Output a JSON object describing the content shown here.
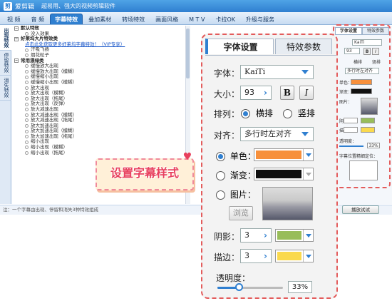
{
  "app": {
    "title": "爱剪辑",
    "subtitle": "超易用、强大的视频剪辑软件"
  },
  "menu": [
    "视 频",
    "音 频",
    "字幕特效",
    "叠加素材",
    "转场特效",
    "画面风格",
    "M T V",
    "卡拉OK",
    "升级与服务"
  ],
  "menu_active": 2,
  "vtabs": [
    "出现特效",
    "停留特效",
    "消失特效"
  ],
  "tree": {
    "groups": [
      {
        "label": "默认特效",
        "items": [
          {
            "label": "没入效果",
            "link": false
          }
        ]
      },
      {
        "label": "好莱坞大片特效类",
        "items": [
          {
            "label": "点击此处获取更多好莱坞字幕特效！（VIP专享）",
            "link": true
          },
          {
            "label": "汗吸飞扬",
            "link": false
          },
          {
            "label": "烟花粒子",
            "link": false
          }
        ]
      },
      {
        "label": "常用漂绿类",
        "items": [
          {
            "label": "缓慢放大出现",
            "link": false
          },
          {
            "label": "缓慢放大出现（模糊）",
            "link": false
          },
          {
            "label": "缓慢缩小出现",
            "link": false
          },
          {
            "label": "缓慢缩小出现（模糊）",
            "link": false
          },
          {
            "label": "放大出现",
            "link": false
          },
          {
            "label": "放大出现（模糊）",
            "link": false
          },
          {
            "label": "放大出现（拖尾）",
            "link": false
          },
          {
            "label": "放大出现（反弹）",
            "link": false
          },
          {
            "label": "放大减速出现",
            "link": false
          },
          {
            "label": "放大减速出现（模糊）",
            "link": false
          },
          {
            "label": "放大减速出现（拖尾）",
            "link": false
          },
          {
            "label": "放大加速出现",
            "link": false
          },
          {
            "label": "放大加速出现（模糊）",
            "link": false
          },
          {
            "label": "放大加速出现（拖尾）",
            "link": false
          },
          {
            "label": "缩小出现",
            "link": false
          },
          {
            "label": "缩小出现（模糊）",
            "link": false
          },
          {
            "label": "缩小出现（拖尾）",
            "link": false
          }
        ]
      }
    ]
  },
  "status_text": "注：一个字幕由出现、停留和消失3种特效组成",
  "preview_button": "播放试试",
  "right_mini": {
    "tabs": [
      "字体设置",
      "特效参数"
    ],
    "font": "KaiTi",
    "size": "93",
    "align": "多行时左对齐",
    "opacity": "33%",
    "rows": [
      "单色：",
      "渐变：",
      "图片：",
      "阴影：",
      "描边：",
      "透明度：",
      "字幕位置精细定位："
    ],
    "radio_h": "横排",
    "radio_v": "竖排"
  },
  "panel": {
    "tabs": [
      "字体设置",
      "特效参数"
    ],
    "font_label": "字体：",
    "font_value": "KaiTi",
    "size_label": "大小：",
    "size_value": "93",
    "bold": "B",
    "italic": "I",
    "layout_label": "排列：",
    "horizontal": "横排",
    "vertical": "竖排",
    "align_label": "对齐：",
    "align_value": "多行时左对齐",
    "solid_label": "单色：",
    "gradient_label": "渐变：",
    "image_label": "图片：",
    "browse": "浏览",
    "shadow_label": "阴影：",
    "shadow_value": "3",
    "stroke_label": "描边：",
    "stroke_value": "3",
    "opacity_label": "透明度：",
    "opacity_value": "33%",
    "opacity_fraction": 0.33
  },
  "colors": {
    "solid": "#f7903c",
    "gradient": "#111111",
    "shadow": "#98bd5a",
    "stroke": "#fad94d",
    "accent": "#2f7fd0",
    "callout": "#e8405d"
  },
  "callout": "设置字幕样式"
}
